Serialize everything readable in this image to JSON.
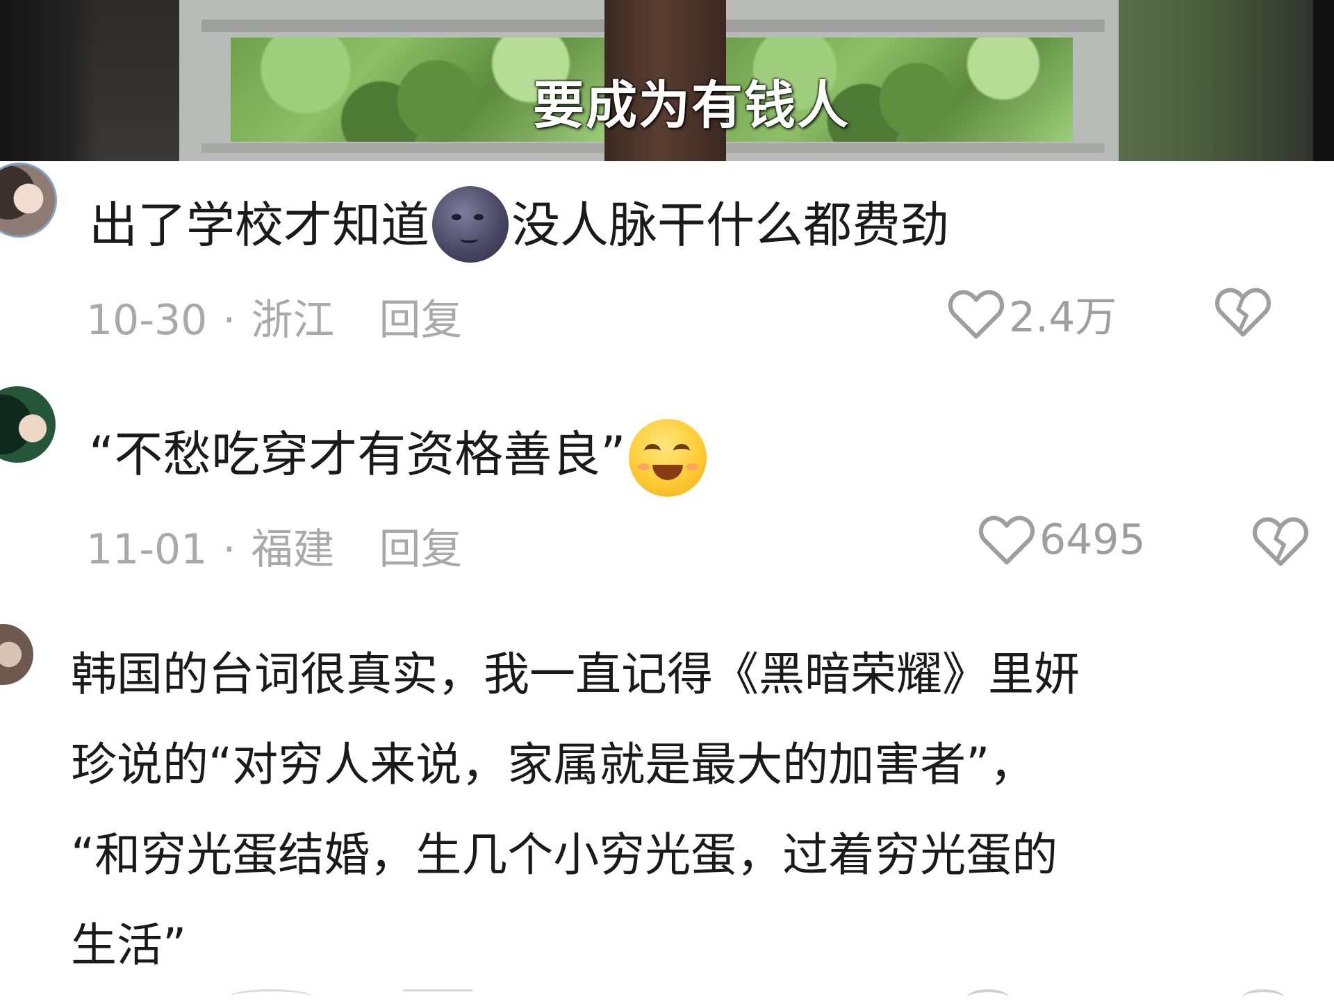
{
  "video": {
    "subtitle": "要成为有钱人"
  },
  "comments": [
    {
      "text_before": "出了学校才知道",
      "emoji": "new-moon-face",
      "text_after": "没人脉干什么都费劲",
      "date": "10-30",
      "separator": "·",
      "location": "浙江",
      "reply_label": "回复",
      "likes": "2.4万"
    },
    {
      "text": "“不愁吃穿才有资格善良”",
      "emoji": "smiling-face",
      "date": "11-01",
      "separator": "·",
      "location": "福建",
      "reply_label": "回复",
      "likes": "6495"
    },
    {
      "lines": [
        "韩国的台词很真实，我一直记得《黑暗荣耀》里妍",
        "珍说的“对穷人来说，家属就是最大的加害者”，",
        "“和穷光蛋结婚，生几个小穷光蛋，过着穷光蛋的",
        "生活”"
      ]
    }
  ],
  "icons": {
    "like": "heart-outline-icon",
    "dislike": "broken-heart-icon"
  },
  "colors": {
    "text": "#1a1a1a",
    "meta": "#a9a9a9",
    "background": "#ffffff"
  }
}
